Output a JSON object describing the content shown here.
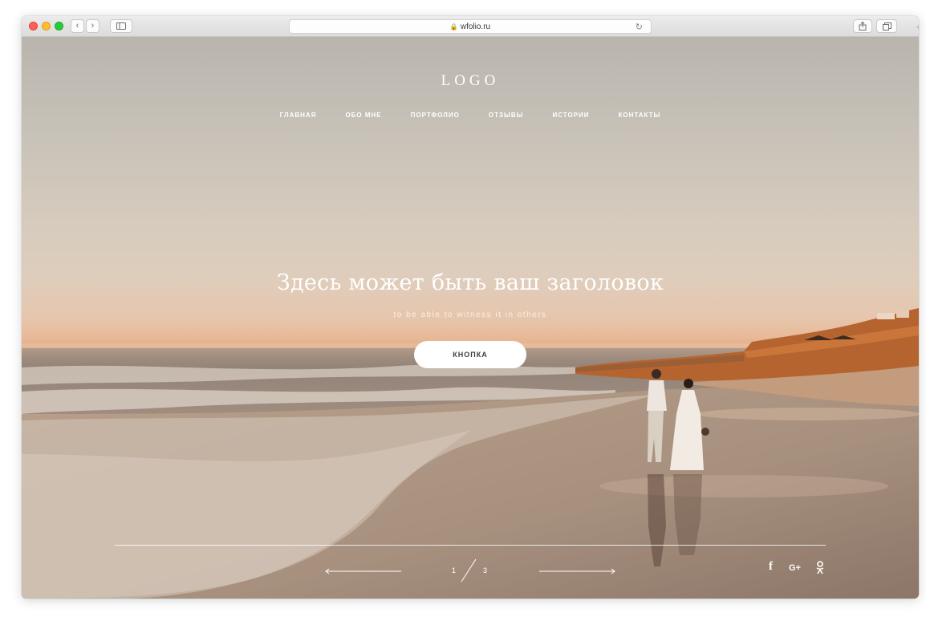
{
  "browser": {
    "address": "wfolio.ru",
    "lock_glyph": "🔒",
    "back_glyph": "‹",
    "forward_glyph": "›",
    "reload_glyph": "↻",
    "new_tab_glyph": "+",
    "icons": [
      "back-icon",
      "forward-icon",
      "sidebar-icon",
      "lock-icon",
      "reload-icon",
      "share-icon",
      "tabs-icon",
      "new-tab-icon"
    ]
  },
  "site": {
    "logo": "LOGO",
    "nav": [
      {
        "label": "ГЛАВНАЯ"
      },
      {
        "label": "ОБО МНЕ"
      },
      {
        "label": "ПОРТФОЛИО"
      },
      {
        "label": "ОТЗЫВЫ"
      },
      {
        "label": "ИСТОРИИ"
      },
      {
        "label": "КОНТАКТЫ"
      }
    ],
    "headline": "Здесь может быть ваш заголовок",
    "subheadline": "to be able to witness it in others",
    "button_label": "КНОПКА",
    "slider": {
      "current": "1",
      "total": "3"
    },
    "social": {
      "facebook": "f",
      "google_plus": "G+",
      "icons": [
        "facebook-icon",
        "google-plus-icon",
        "odnoklassniki-icon"
      ]
    }
  },
  "colors": {
    "sky_top": "#b9b5ae",
    "horizon": "#e8b997",
    "sand": "#b39a86",
    "cliff": "#b5642f",
    "button_bg": "#ffffff",
    "text_on_image": "#ffffff"
  }
}
